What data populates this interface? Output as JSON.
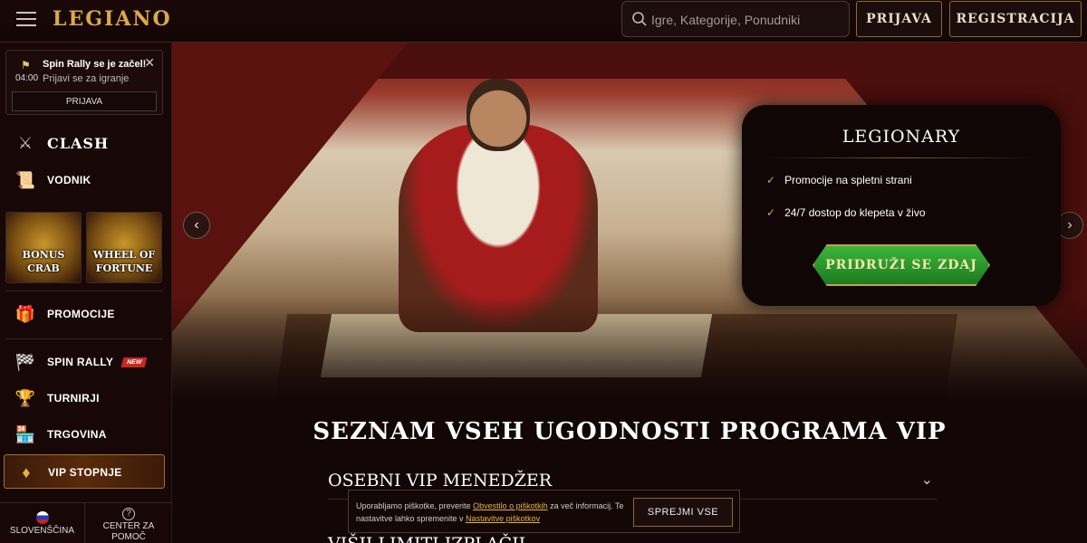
{
  "header": {
    "logo": "LEGIANO",
    "search_placeholder": "Igre, Kategorije, Ponudniki",
    "login_label": "PRIJAVA",
    "register_label": "REGISTRACIJA"
  },
  "notification": {
    "title": "Spin Rally se je začel!",
    "time": "04:00",
    "subtitle": "Prijavi se za igranje",
    "button": "PRIJAVA"
  },
  "sidebar": {
    "clash": "CLASH",
    "vodnik": "VODNIK",
    "tiles": [
      {
        "label1": "BONUS",
        "label2": "CRAB"
      },
      {
        "label1": "WHEEL OF",
        "label2": "FORTUNE"
      }
    ],
    "promocije": "PROMOCIJE",
    "spin_rally": "SPIN RALLY",
    "new_badge": "NEW",
    "turnirji": "TURNIRJI",
    "trgovina": "TRGOVINA",
    "vip": "VIP STOPNJE",
    "language": "SLOVENŠČINA",
    "help1": "CENTER ZA",
    "help2": "POMOČ"
  },
  "promo": {
    "title": "LEGIONARY",
    "features": [
      "Promocije na spletni strani",
      "24/7 dostop do klepeta v živo"
    ],
    "cta": "PRIDRUŽI SE ZDAJ"
  },
  "content": {
    "title": "SEZNAM VSEH UGODNOSTI PROGRAMA VIP",
    "accordion": [
      "OSEBNI VIP MENEDŽER",
      "VIŠJI LIMITI IZPLAČIL"
    ]
  },
  "cookie": {
    "text1": "Uporabljamo piškotke, preverite ",
    "link1": "Obvestilo o piškotkih",
    "text2": " za več informacij. Te nastavitve lahko spremenite v ",
    "link2": "Nastavitve piškotkov",
    "button": "SPREJMI VSE"
  },
  "colors": {
    "accent": "#d9a94a",
    "background": "#120606",
    "cta_green": "#2a9a2a"
  }
}
